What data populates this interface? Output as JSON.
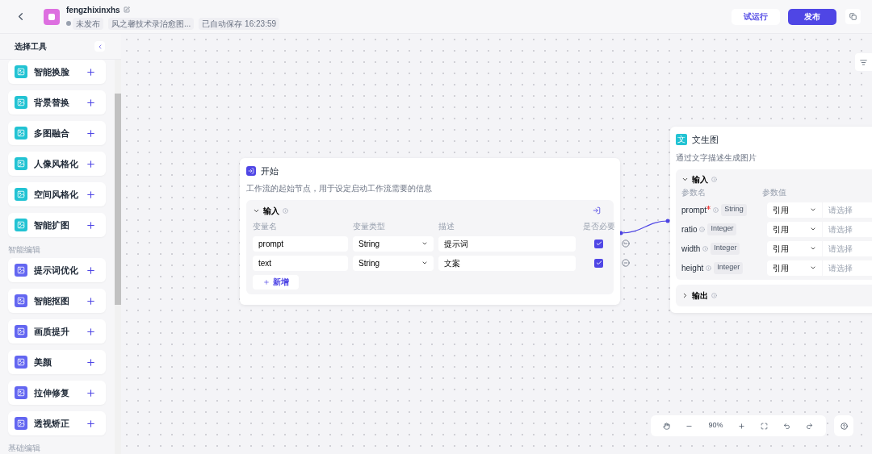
{
  "header": {
    "app_name": "fengzhixinxhs",
    "status": "未发布",
    "workflow_badge": "风之馨技术录治愈图...",
    "autosave": "已自动保存 16:23:59",
    "buttons": [
      {
        "label": "试运行",
        "kind": "secondary"
      },
      {
        "label": "发布",
        "kind": "primary"
      }
    ]
  },
  "sidebar": {
    "title": "选择工具",
    "items": [
      {
        "kind": "tool",
        "label": "智能换脸",
        "color": "#22c3d3"
      },
      {
        "kind": "tool",
        "label": "背景替换",
        "color": "#22c3d3"
      },
      {
        "kind": "tool",
        "label": "多图融合",
        "color": "#22c3d3"
      },
      {
        "kind": "tool",
        "label": "人像风格化",
        "color": "#22c3d3"
      },
      {
        "kind": "tool",
        "label": "空间风格化",
        "color": "#22c3d3"
      },
      {
        "kind": "tool",
        "label": "智能扩图",
        "color": "#22c3d3"
      },
      {
        "kind": "section",
        "label": "智能编辑"
      },
      {
        "kind": "tool",
        "label": "提示词优化",
        "color": "#6366f1"
      },
      {
        "kind": "tool",
        "label": "智能抠图",
        "color": "#6366f1"
      },
      {
        "kind": "tool",
        "label": "画质提升",
        "color": "#6366f1"
      },
      {
        "kind": "tool",
        "label": "美颜",
        "color": "#6366f1"
      },
      {
        "kind": "tool",
        "label": "拉伸修复",
        "color": "#6366f1"
      },
      {
        "kind": "tool",
        "label": "透视矫正",
        "color": "#6366f1"
      },
      {
        "kind": "section",
        "label": "基础编辑"
      }
    ]
  },
  "start_node": {
    "title": "开始",
    "description": "工作流的起始节点，用于设定启动工作流需要的信息",
    "input": {
      "title": "输入",
      "expanded": true,
      "columns": [
        "变量名",
        "变量类型",
        "描述",
        "是否必要"
      ],
      "rows": [
        {
          "name": "prompt",
          "type": "String",
          "description": "提示词",
          "required": true
        },
        {
          "name": "text",
          "type": "String",
          "description": "文案",
          "required": true
        }
      ],
      "add_button": "新增"
    }
  },
  "text_to_image_node": {
    "icon_text": "文",
    "title": "文生图",
    "description": "通过文字描述生成图片",
    "input": {
      "title": "输入",
      "expanded": true,
      "columns": [
        "参数名",
        "参数值"
      ],
      "params": [
        {
          "name": "prompt",
          "required": true,
          "type": "String",
          "source": "引用",
          "placeholder": "请选择"
        },
        {
          "name": "ratio",
          "required": false,
          "type": "Integer",
          "source": "引用",
          "placeholder": "请选择"
        },
        {
          "name": "width",
          "required": false,
          "type": "Integer",
          "source": "引用",
          "placeholder": "请选择"
        },
        {
          "name": "height",
          "required": false,
          "type": "Integer",
          "source": "引用",
          "placeholder": "请选择"
        }
      ]
    },
    "output": {
      "title": "输出",
      "expanded": false
    }
  },
  "zoom_toolbar": {
    "zoom": "90%"
  }
}
